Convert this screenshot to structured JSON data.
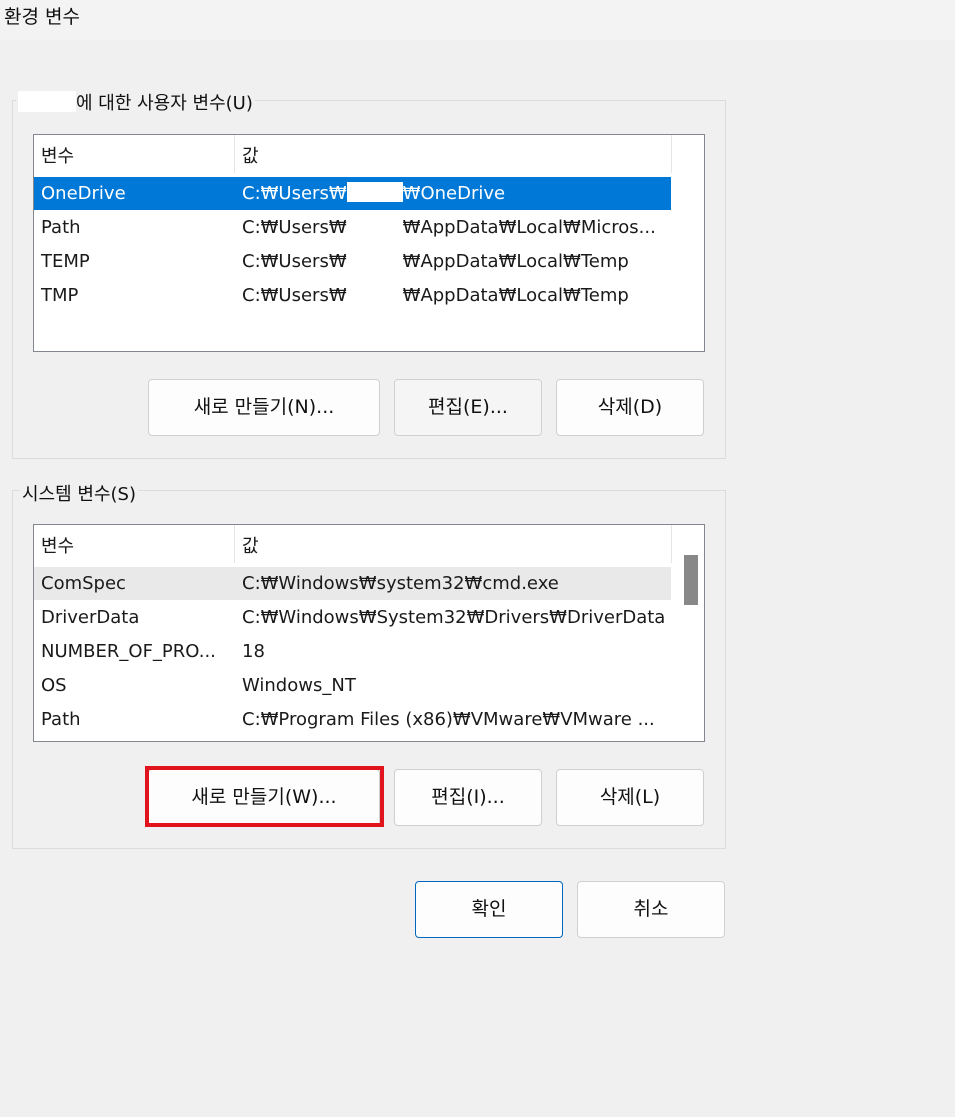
{
  "window": {
    "title": "환경 변수"
  },
  "user_section": {
    "label_suffix": "에 대한 사용자 변수(U)",
    "columns": [
      "변수",
      "값"
    ],
    "rows": [
      {
        "name": "OneDrive",
        "value_pre": "C:₩Users₩",
        "value_post": "₩OneDrive",
        "selected": true
      },
      {
        "name": "Path",
        "value_pre": "C:₩Users₩",
        "value_post": "₩AppData₩Local₩Micros..."
      },
      {
        "name": "TEMP",
        "value_pre": "C:₩Users₩",
        "value_post": "₩AppData₩Local₩Temp"
      },
      {
        "name": "TMP",
        "value_pre": "C:₩Users₩",
        "value_post": "₩AppData₩Local₩Temp"
      }
    ],
    "buttons": {
      "new": "새로 만들기(N)...",
      "edit": "편집(E)...",
      "delete": "삭제(D)"
    }
  },
  "system_section": {
    "label": "시스템 변수(S)",
    "columns": [
      "변수",
      "값"
    ],
    "rows": [
      {
        "name": "ComSpec",
        "value": "C:₩Windows₩system32₩cmd.exe"
      },
      {
        "name": "DriverData",
        "value": "C:₩Windows₩System32₩Drivers₩DriverData"
      },
      {
        "name": "NUMBER_OF_PRO...",
        "value": "18"
      },
      {
        "name": "OS",
        "value": "Windows_NT"
      },
      {
        "name": "Path",
        "value": "C:₩Program Files (x86)₩VMware₩VMware ..."
      }
    ],
    "buttons": {
      "new": "새로 만들기(W)...",
      "edit": "편집(I)...",
      "delete": "삭제(L)"
    }
  },
  "footer": {
    "ok": "확인",
    "cancel": "취소"
  },
  "colors": {
    "selection": "#0078d7",
    "highlight": "#e1141e",
    "primary_border": "#0067c0"
  }
}
